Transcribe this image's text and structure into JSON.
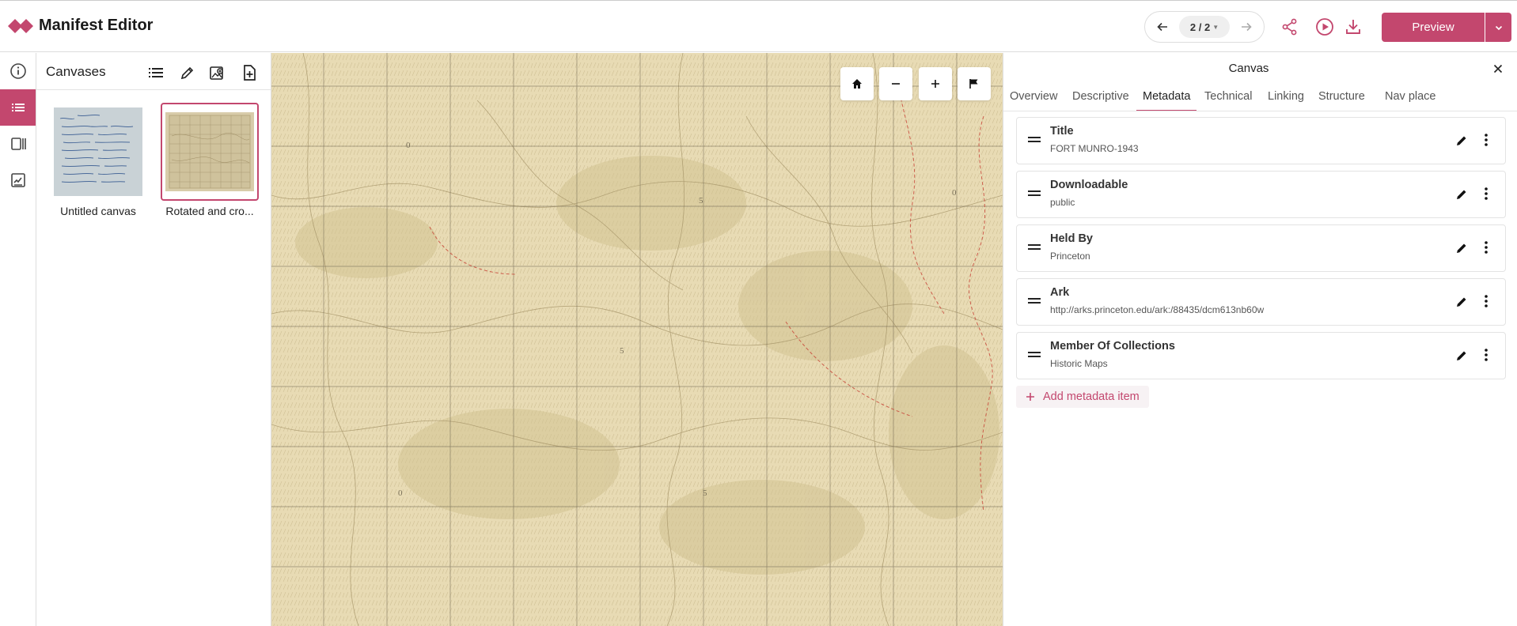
{
  "header": {
    "app_title": "Manifest Editor",
    "page_indicator": "2 / 2",
    "preview_label": "Preview",
    "accent_color": "#c3476e"
  },
  "icons": {
    "logo": "manifest-editor-logo",
    "prev": "arrow-left-icon",
    "next": "arrow-right-icon",
    "share": "share-icon",
    "play": "play-circle-icon",
    "download": "download-icon"
  },
  "rail": {
    "items": [
      {
        "icon": "info-icon"
      },
      {
        "icon": "list-icon",
        "active": true
      },
      {
        "icon": "panels-icon"
      },
      {
        "icon": "annotation-icon"
      }
    ]
  },
  "canvas_panel": {
    "title": "Canvases",
    "tools": [
      "list-view-icon",
      "edit-icon",
      "add-image-icon",
      "add-canvas-icon"
    ],
    "items": [
      {
        "label": "Untitled canvas",
        "selected": false
      },
      {
        "label": "Rotated and cro...",
        "selected": true
      }
    ]
  },
  "viewer": {
    "controls": [
      "home-icon",
      "zoom-out-icon",
      "zoom-in-icon",
      "flag-icon"
    ]
  },
  "right_panel": {
    "title": "Canvas",
    "tabs": [
      "Overview",
      "Descriptive",
      "Metadata",
      "Technical",
      "Linking",
      "Structure",
      "Nav place"
    ],
    "active_tab": "Metadata",
    "metadata": [
      {
        "label": "Title",
        "value": "FORT MUNRO-1943"
      },
      {
        "label": "Downloadable",
        "value": "public"
      },
      {
        "label": "Held By",
        "value": "Princeton"
      },
      {
        "label": "Ark",
        "value": "http://arks.princeton.edu/ark:/88435/dcm613nb60w"
      },
      {
        "label": "Member Of Collections",
        "value": "Historic Maps"
      }
    ],
    "add_label": "Add metadata item"
  }
}
